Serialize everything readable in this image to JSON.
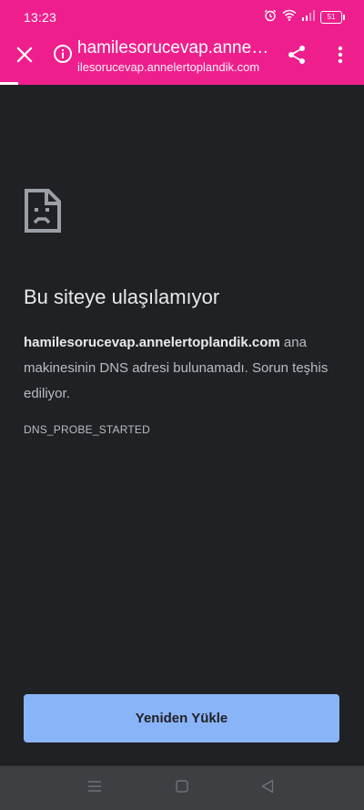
{
  "status_bar": {
    "time": "13:23",
    "battery": "51",
    "icons": [
      "alarm-icon",
      "wifi-icon",
      "signal-icon",
      "battery-icon"
    ]
  },
  "toolbar": {
    "title": "hamilesorucevap.anneler...",
    "url": "ilesorucevap.annelertoplandik.com",
    "icons": [
      "close-icon",
      "info-icon",
      "share-icon",
      "more-vert-icon"
    ],
    "accent_color": "#ee1f8c"
  },
  "error": {
    "icon": "sad-file-icon",
    "title": "Bu siteye ulaşılamıyor",
    "host": "hamilesorucevap.annelertoplandik.com",
    "message": " ana makinesinin DNS adresi bulunamadı. Sorun teşhis ediliyor.",
    "code": "DNS_PROBE_STARTED"
  },
  "actions": {
    "reload_label": "Yeniden Yükle",
    "reload_color": "#8ab4f8"
  },
  "nav_bar": {
    "icons": [
      "recents-menu-icon",
      "home-square-icon",
      "back-triangle-icon"
    ]
  },
  "theme": {
    "background": "#202124",
    "text": "#e8eaed"
  }
}
